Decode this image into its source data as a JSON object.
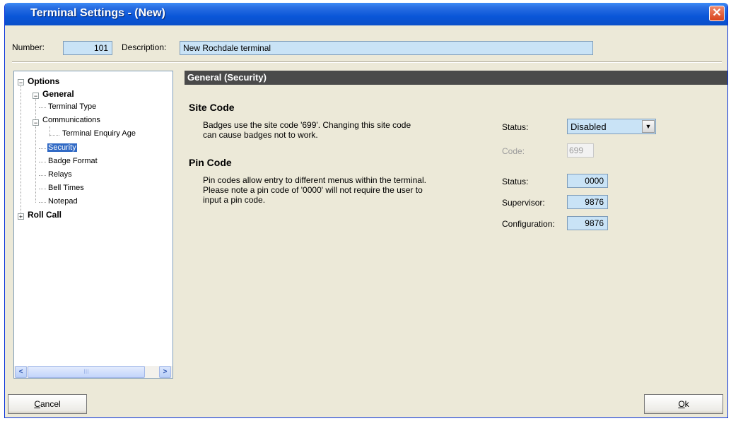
{
  "window": {
    "title": "Terminal Settings - (New)"
  },
  "header": {
    "number_label": "Number:",
    "number_value": "101",
    "description_label": "Description:",
    "description_value": "New Rochdale terminal"
  },
  "tree": {
    "options": "Options",
    "general": "General",
    "terminal_type": "Terminal Type",
    "communications": "Communications",
    "terminal_enquiry_agent": "Terminal Enquiry Age",
    "security": "Security",
    "badge_format": "Badge Format",
    "relays": "Relays",
    "bell_times": "Bell Times",
    "notepad": "Notepad",
    "roll_call": "Roll Call",
    "scroll_thumb_grip": "III"
  },
  "panel": {
    "section_title": "General (Security)",
    "site_code": {
      "heading": "Site Code",
      "description_line1": "Badges use the site code '699'. Changing this site code",
      "description_line2": "can cause badges not to work.",
      "status_label": "Status:",
      "status_value": "Disabled",
      "code_label": "Code:",
      "code_value": "699"
    },
    "pin_code": {
      "heading": "Pin Code",
      "description_line1": "Pin codes allow entry to different menus within the terminal.",
      "description_line2": "Please note a pin code of '0000' will not require the user to",
      "description_line3": "input a pin code.",
      "status_label": "Status:",
      "status_value": "0000",
      "supervisor_label": "Supervisor:",
      "supervisor_value": "9876",
      "configuration_label": "Configuration:",
      "configuration_value": "9876"
    }
  },
  "footer": {
    "cancel_first": "C",
    "cancel_rest": "ancel",
    "ok_first": "O",
    "ok_rest": "k"
  },
  "colors": {
    "titlebar": "#0a56d8",
    "field_bg": "#c9e3f6",
    "section_header_bg": "#4a4a4a",
    "selection": "#316ac5"
  }
}
